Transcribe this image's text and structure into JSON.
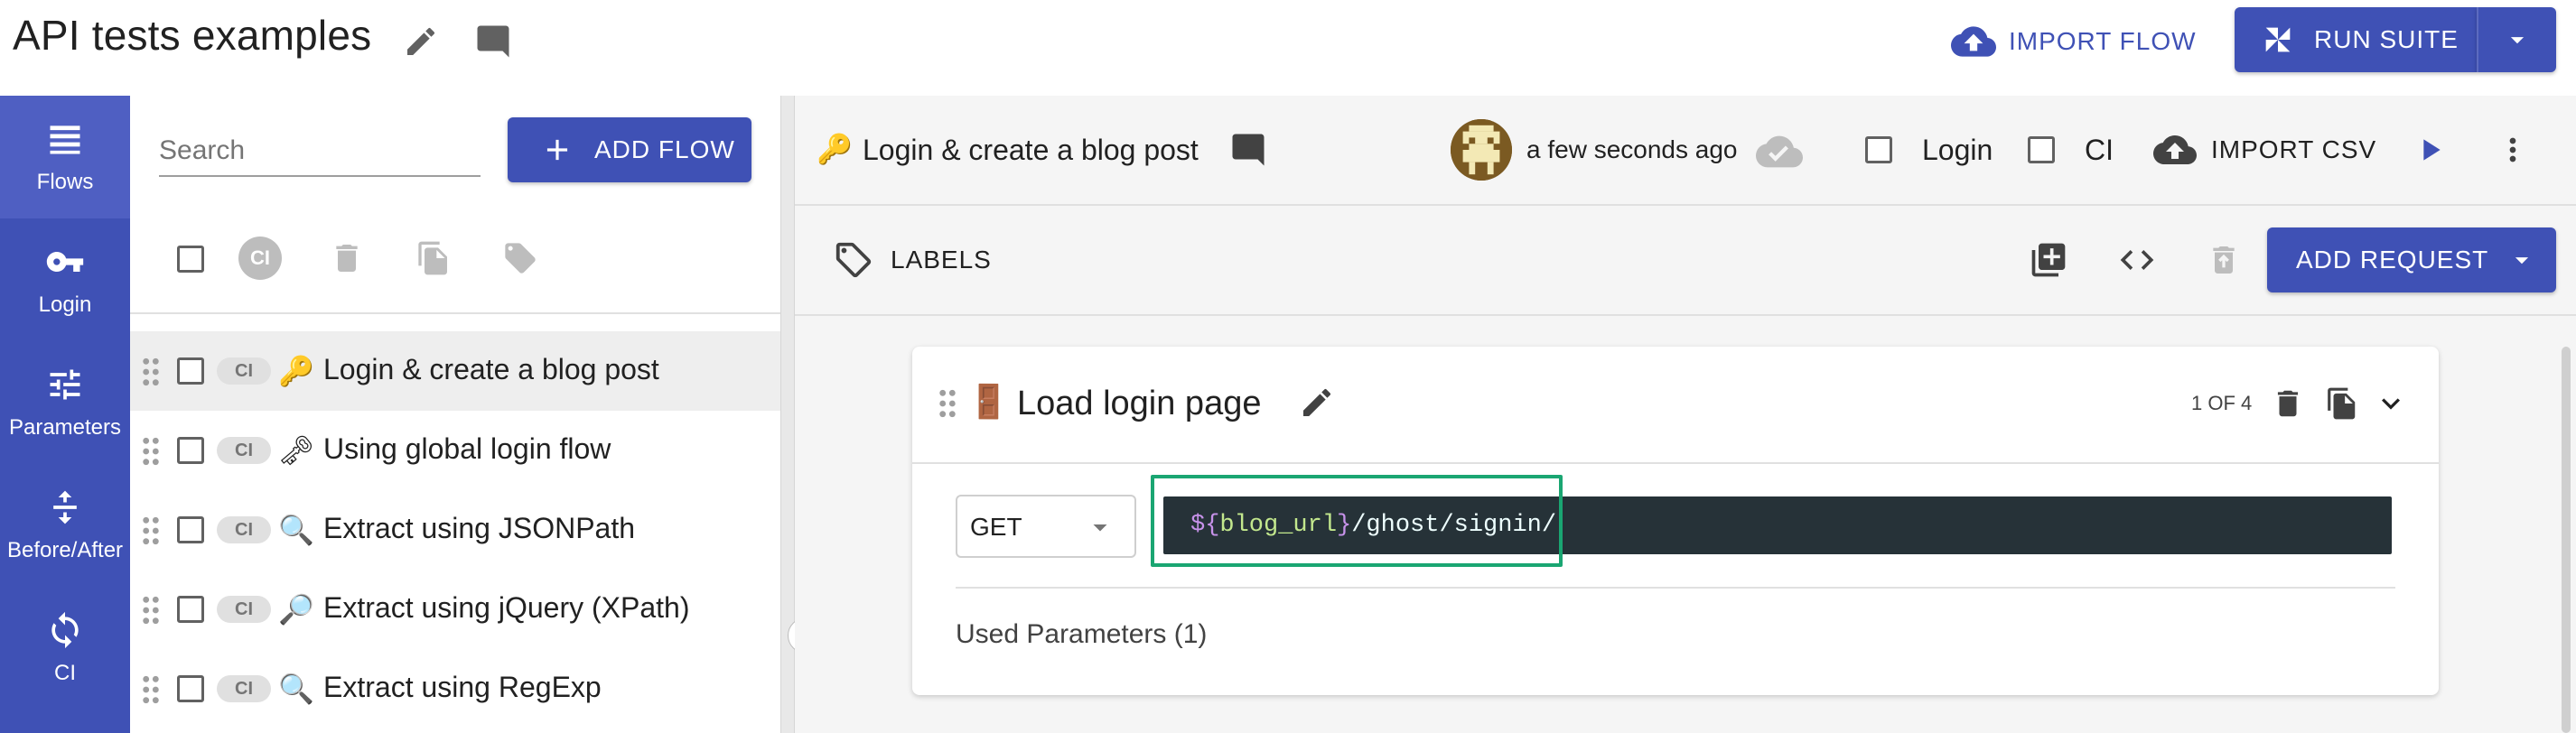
{
  "app": {
    "title": "API tests examples"
  },
  "topbar": {
    "import_flow_label": "IMPORT FLOW",
    "run_suite_label": "RUN SUITE"
  },
  "nav": {
    "items": [
      {
        "label": "Flows",
        "icon": "list-icon",
        "active": true
      },
      {
        "label": "Login",
        "icon": "key-icon"
      },
      {
        "label": "Parameters",
        "icon": "tune-icon"
      },
      {
        "label": "Before/After",
        "icon": "vertical-split-icon"
      },
      {
        "label": "CI",
        "icon": "sync-icon"
      }
    ]
  },
  "flows_panel": {
    "search_placeholder": "Search",
    "search_value": "",
    "add_flow_label": "ADD FLOW",
    "toolbar": {
      "ci_label": "CI"
    },
    "flows": [
      {
        "name": "Login & create a blog post",
        "ci": "CI",
        "emoji": "🔑",
        "selected": true
      },
      {
        "name": "Using global login flow",
        "ci": "CI",
        "emoji": "🗝"
      },
      {
        "name": "Extract using JSONPath",
        "ci": "CI",
        "emoji": "🔍"
      },
      {
        "name": "Extract using jQuery (XPath)",
        "ci": "CI",
        "emoji": "🔎"
      },
      {
        "name": "Extract using RegExp",
        "ci": "CI",
        "emoji": "🔍"
      }
    ]
  },
  "flow_header": {
    "emoji": "🔑",
    "title": "Login & create a blog post",
    "saved_time": "a few seconds ago",
    "login_label": "Login",
    "ci_label": "CI",
    "import_csv_label": "IMPORT CSV"
  },
  "flow_toolbar": {
    "labels_label": "LABELS",
    "add_request_label": "ADD REQUEST"
  },
  "request_card": {
    "emoji": "🚪",
    "title": "Load login page",
    "position": "1 OF 4",
    "method": "GET",
    "url_prefix": "${",
    "url_var": "blog_url",
    "url_suffix_brace": "}",
    "url_path": "/ghost/signin/",
    "used_params_label": "Used Parameters (1)"
  },
  "colors": {
    "primary": "#3f51b5",
    "url_bg": "#263238",
    "highlight": "#1aa672",
    "var_color": "#c3e88d",
    "brace_color": "#c792ea"
  }
}
